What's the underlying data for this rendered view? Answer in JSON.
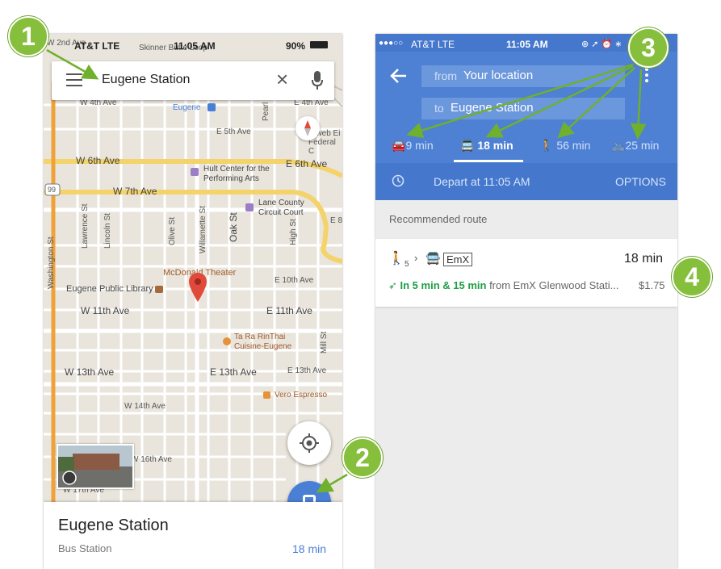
{
  "left": {
    "status": {
      "carrier": "AT&T  LTE",
      "time": "11:05 AM",
      "battery": "90%"
    },
    "search": {
      "query": "Eugene Station"
    },
    "map_labels": {
      "w2nd": "W 2nd Ave",
      "skinner": "Skinner Butte Loop",
      "w4th": "W 4th Ave",
      "e4th": "E 4th Ave",
      "eugene": "Eugene",
      "e5th": "E 5th Ave",
      "pearl": "Pearl St",
      "webfed": "Wweb Ei Federal C",
      "w6th": "W 6th Ave",
      "e6th": "E 6th Ave",
      "hult": "Hult Center for the Performing Arts",
      "w7th": "W 7th Ave",
      "route99": "99",
      "lane": "Lane County Circuit Court",
      "e8": "E 8",
      "washington": "Washington St",
      "lawrence": "Lawrence St",
      "lincoln": "Lincoln St",
      "olive": "Olive St",
      "willamette": "Willamette St",
      "oak": "Oak St",
      "high": "High St",
      "mcdonald": "McDonald Theater",
      "library": "Eugene Public Library",
      "e10th": "E 10th Ave",
      "w11th": "W 11th Ave",
      "e11th": "E 11th Ave",
      "tarathai": "Ta Ra RinThai Cuisine-Eugene",
      "mill": "Mill St",
      "w13th": "W 13th Ave",
      "e13th": "E 13th Ave",
      "e13th2": "E 13th Ave",
      "vero": "Vero Espresso",
      "w14th": "W 14th Ave",
      "w16th": "W 16th Ave",
      "w17th": "W 17th Ave"
    },
    "place": {
      "name": "Eugene Station",
      "type": "Bus Station",
      "eta": "18 min"
    }
  },
  "right": {
    "status": {
      "carrier": "AT&T  LTE",
      "time": "11:05 AM"
    },
    "from_prefix": "from",
    "from_value": "Your location",
    "to_prefix": "to",
    "to_value": "Eugene Station",
    "modes": {
      "drive": "9 min",
      "transit": "18 min",
      "walk": "56 min",
      "bike": "25 min"
    },
    "depart": "Depart at 11:05 AM",
    "options": "OPTIONS",
    "recommended": "Recommended route",
    "route": {
      "walk_sub": "5",
      "line": "EmX",
      "duration": "18 min",
      "realtime": "In 5 min & 15 min",
      "from_text": "from EmX Glenwood Stati...",
      "fare": "$1.75"
    }
  },
  "callouts": {
    "c1": "1",
    "c2": "2",
    "c3": "3",
    "c4": "4"
  },
  "colors": {
    "accent_blue": "#4e80d3",
    "callout_green": "#86bf3c",
    "pin_red": "#e04a3b",
    "transit_green": "#1e9e45"
  }
}
